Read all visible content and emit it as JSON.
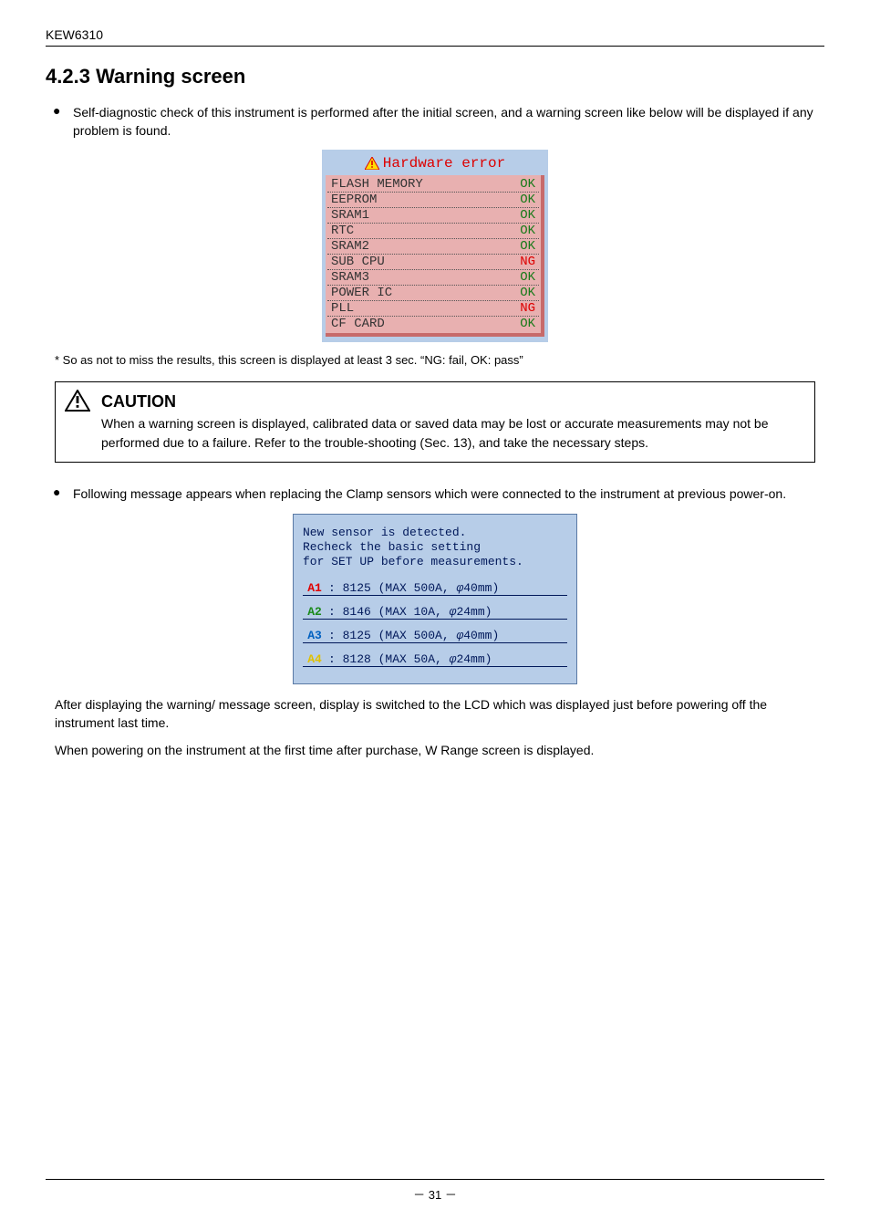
{
  "header": {
    "model": "KEW6310"
  },
  "section_number": "4.2.3",
  "section_title": "Warning screen",
  "bullet1": "Self-diagnostic check of this instrument is performed after the initial screen, and a warning screen like below will be displayed if any problem is found.",
  "hw": {
    "title": "Hardware error",
    "rows": [
      {
        "name": "FLASH MEMORY",
        "status": "OK"
      },
      {
        "name": "EEPROM",
        "status": "OK"
      },
      {
        "name": "SRAM1",
        "status": "OK"
      },
      {
        "name": "RTC",
        "status": "OK"
      },
      {
        "name": "SRAM2",
        "status": "OK"
      },
      {
        "name": "SUB CPU",
        "status": "NG"
      },
      {
        "name": "SRAM3",
        "status": "OK"
      },
      {
        "name": "POWER IC",
        "status": "OK"
      },
      {
        "name": "PLL",
        "status": "NG"
      },
      {
        "name": "CF CARD",
        "status": "OK"
      }
    ]
  },
  "hw_caption_prefix": "* So as not to miss the results, this screen is displayed at least 3 sec. ",
  "hw_caption_quote": "NG: fail, OK: pass",
  "caution_label": "CAUTION",
  "caution_text": "When a warning screen is displayed, calibrated data or saved data may be lost or accurate measurements may not be performed due to a failure. Refer to the trouble-shooting (Sec. 13), and take the necessary steps.",
  "bullet2": "Following message appears when replacing the Clamp sensors which were connected to the instrument at previous power-on.",
  "sensor_msg": "New sensor is detected.\nRecheck the basic setting\nfor SET UP before measurements.",
  "sensor_rows": [
    {
      "ch": "A1",
      "cls": "ch-A1",
      "text": ": 8125 (MAX  500A,  φ40mm)"
    },
    {
      "ch": "A2",
      "cls": "ch-A2",
      "text": ": 8146 (MAX   10A,  φ24mm)"
    },
    {
      "ch": "A3",
      "cls": "ch-A3",
      "text": ": 8125 (MAX  500A,  φ40mm)"
    },
    {
      "ch": "A4",
      "cls": "ch-A4",
      "text": ": 8128 (MAX   50A,  φ24mm)"
    }
  ],
  "after1": "After displaying the warning/ message screen, display is switched to the LCD which was displayed just before powering off the instrument last time.",
  "after2": "When powering on the instrument at the first time after purchase, W Range screen is displayed.",
  "footer_page": "－ 31 －"
}
